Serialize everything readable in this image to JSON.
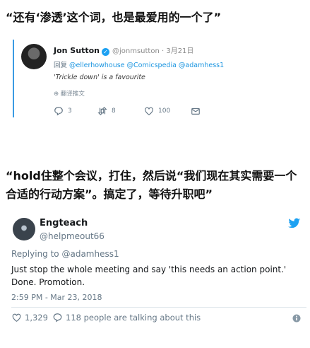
{
  "captions": {
    "first": "“还有‘渗透’这个词，也是最爱用的一个了”",
    "second": "“hold住整个会议，打住，然后说“我们现在其实需要一个合适的行动方案”。搞定了，等待升职吧”"
  },
  "tweet1": {
    "name": "Jon Sutton",
    "handle": "@jonmsutton · 3月21日",
    "reply_prefix": "回复",
    "reply_mentions": "@ellerhowhouse @Comicspedia @adamhess1",
    "text": "'Trickle down' is a favourite",
    "translate": "翻译推文",
    "replies": "3",
    "retweets": "8",
    "likes": "100"
  },
  "tweet2": {
    "name": "Engteach",
    "handle": "@helpmeout66",
    "reply_to": "Replying to @adamhess1",
    "body": "Just stop the whole meeting and say 'this needs an action point.' Done. Promotion.",
    "timestamp": "2:59 PM - Mar 23, 2018",
    "likes": "1,329",
    "talking": "118 people are talking about this"
  },
  "colors": {
    "accent": "#1da1f2",
    "link": "#1b95e0",
    "muted": "#657786",
    "like_red": "#e0245e"
  }
}
